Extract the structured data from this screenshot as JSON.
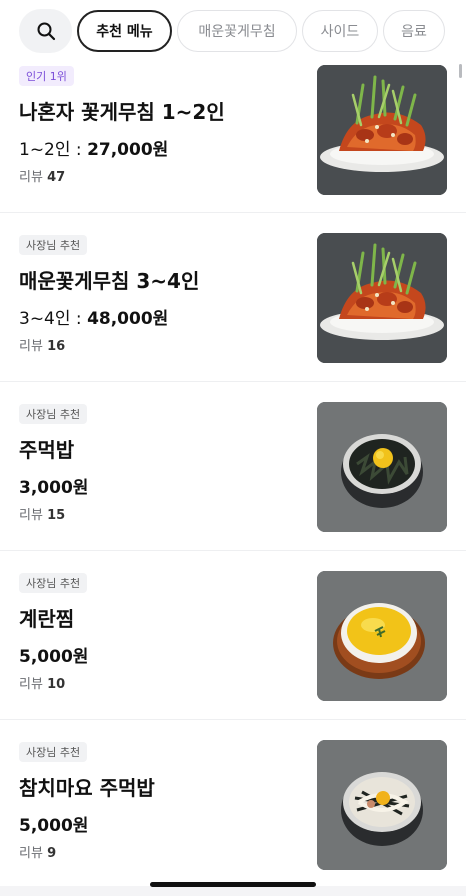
{
  "search": {
    "icon": "search-icon"
  },
  "tabs": [
    {
      "label": "추천 메뉴",
      "active": true
    },
    {
      "label": "매운꽃게무침",
      "active": false
    },
    {
      "label": "사이드",
      "active": false
    },
    {
      "label": "음료",
      "active": false
    }
  ],
  "menu": [
    {
      "badge": "인기 1위",
      "badge_style": "popular",
      "name": "나혼자 꽃게무침 1~2인",
      "price_prefix": "1~2인 : ",
      "price": "27,000원",
      "review_label": "리뷰",
      "review_count": "47",
      "image": "spicy-crab-dish"
    },
    {
      "badge": "사장님 추천",
      "badge_style": "owner",
      "name": "매운꽃게무침 3~4인",
      "price_prefix": "3~4인 : ",
      "price": "48,000원",
      "review_label": "리뷰",
      "review_count": "16",
      "image": "spicy-crab-dish"
    },
    {
      "badge": "사장님 추천",
      "badge_style": "owner",
      "name": "주먹밥",
      "price_prefix": "",
      "price": "3,000원",
      "review_label": "리뷰",
      "review_count": "15",
      "image": "rice-ball-bowl"
    },
    {
      "badge": "사장님 추천",
      "badge_style": "owner",
      "name": "계란찜",
      "price_prefix": "",
      "price": "5,000원",
      "review_label": "리뷰",
      "review_count": "10",
      "image": "steamed-egg-bowl"
    },
    {
      "badge": "사장님 추천",
      "badge_style": "owner",
      "name": "참치마요 주먹밥",
      "price_prefix": "",
      "price": "5,000원",
      "review_label": "리뷰",
      "review_count": "9",
      "image": "tuna-mayo-rice-bowl"
    }
  ],
  "colors": {
    "popular_badge_text": "#7a4cd8",
    "popular_badge_bg": "#f2ecfd",
    "owner_badge_bg": "#f1f2f4",
    "active_chip_border": "#222222"
  }
}
